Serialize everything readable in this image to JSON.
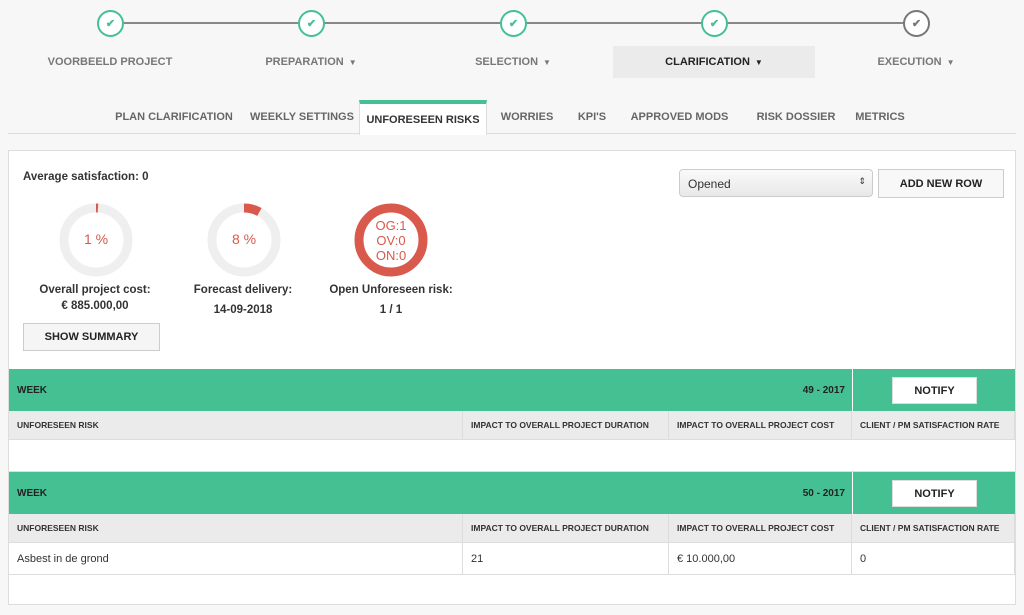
{
  "stepper": [
    {
      "label": "VOORBEELD PROJECT",
      "done": true,
      "caret": false
    },
    {
      "label": "PREPARATION",
      "done": true,
      "caret": true
    },
    {
      "label": "SELECTION",
      "done": true,
      "caret": true
    },
    {
      "label": "CLARIFICATION",
      "done": true,
      "caret": true,
      "active": true
    },
    {
      "label": "EXECUTION",
      "done": false,
      "caret": true
    }
  ],
  "tabs": [
    "PLAN CLARIFICATION",
    "WEEKLY SETTINGS",
    "UNFORESEEN RISKS",
    "WORRIES",
    "KPI'S",
    "APPROVED MODS",
    "RISK DOSSIER",
    "METRICS"
  ],
  "active_tab": "UNFORESEEN RISKS",
  "summary": {
    "avg_satisfaction": "Average satisfaction: 0",
    "cost_pct": "1 %",
    "cost_value": 1,
    "cost_label": "Overall project cost:",
    "cost_amount": "€ 885.000,00",
    "delivery_pct": "8 %",
    "delivery_value": 8,
    "delivery_label": "Forecast delivery:",
    "delivery_date": "14-09-2018",
    "risk_lines": [
      "OG:1",
      "OV:0",
      "ON:0"
    ],
    "risk_label": "Open Unforeseen risk:",
    "risk_count": "1 / 1",
    "show_summary": "SHOW SUMMARY"
  },
  "filter": {
    "selected": "Opened",
    "add_row": "ADD NEW ROW"
  },
  "columns": [
    "UNFORESEEN RISK",
    "IMPACT TO OVERALL PROJECT DURATION",
    "IMPACT TO OVERALL PROJECT COST",
    "CLIENT / PM SATISFACTION RATE"
  ],
  "weeks": [
    {
      "label": "WEEK",
      "week": "49 - 2017",
      "notify": "NOTIFY",
      "rows": []
    },
    {
      "label": "WEEK",
      "week": "50 - 2017",
      "notify": "NOTIFY",
      "rows": [
        [
          "Asbest in de grond",
          "21",
          "€ 10.000,00",
          "0"
        ]
      ]
    }
  ],
  "colors": {
    "accent": "#44c093",
    "danger": "#d9594c"
  }
}
